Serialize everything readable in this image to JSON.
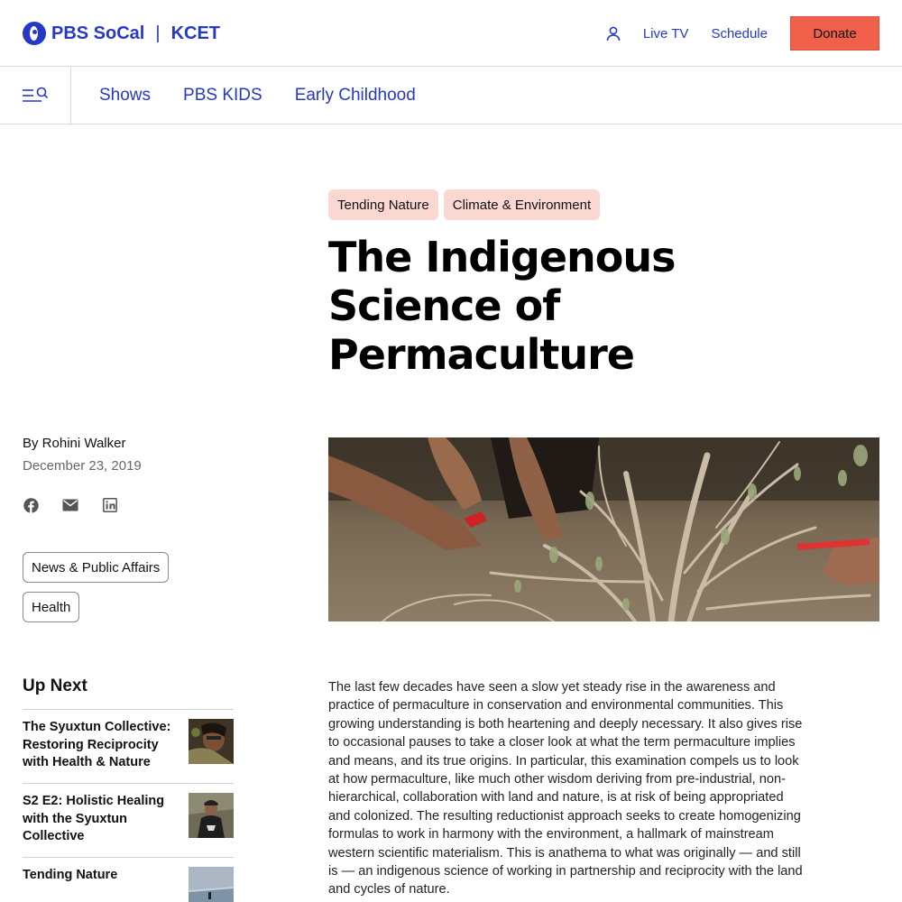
{
  "header": {
    "logo_primary": "PBS SoCal",
    "logo_divider": "|",
    "logo_secondary": "KCET",
    "nav": {
      "live_tv": "Live TV",
      "schedule": "Schedule"
    },
    "donate_label": "Donate"
  },
  "subnav": {
    "items": [
      {
        "label": "Shows"
      },
      {
        "label": "PBS KIDS"
      },
      {
        "label": "Early Childhood"
      }
    ]
  },
  "article": {
    "tags": [
      "Tending Nature",
      "Climate & Environment"
    ],
    "title": "The Indigenous Science of Permaculture",
    "byline": "By Rohini Walker",
    "date": "December 23, 2019",
    "categories": [
      "News & Public Affairs",
      "Health"
    ],
    "body": "The last few decades have seen a slow yet steady rise in the awareness and practice of permaculture in conservation and environmental communities. This growing understanding is both heartening and deeply necessary. It also gives rise to occasional pauses to take a closer look at what the term permaculture implies and means, and its true origins. In particular, this examination compels us to look at how permaculture, like much other wisdom deriving from pre-industrial, non-hierarchical, collaboration with land and nature, is at risk of being appropriated and colonized. The resulting reductionist approach seeks to create homogenizing formulas to work in harmony with the environment, a hallmark of mainstream western scientific materialism. This is anathema to what was originally — and still is — an indigenous science of working in partnership and reciprocity with the land and cycles of nature."
  },
  "share_icons": [
    "facebook-icon",
    "email-icon",
    "linkedin-icon"
  ],
  "up_next": {
    "heading": "Up Next",
    "items": [
      {
        "title": "The Syuxtun Collective: Restoring Reciprocity with Health & Nature"
      },
      {
        "title": "S2 E2: Holistic Healing with the Syuxtun Collective"
      },
      {
        "title": "Tending Nature"
      }
    ]
  },
  "colors": {
    "brand_blue": "#2638c4",
    "donate_orange": "#f0604a",
    "tag_pink": "#fbd7d2"
  }
}
